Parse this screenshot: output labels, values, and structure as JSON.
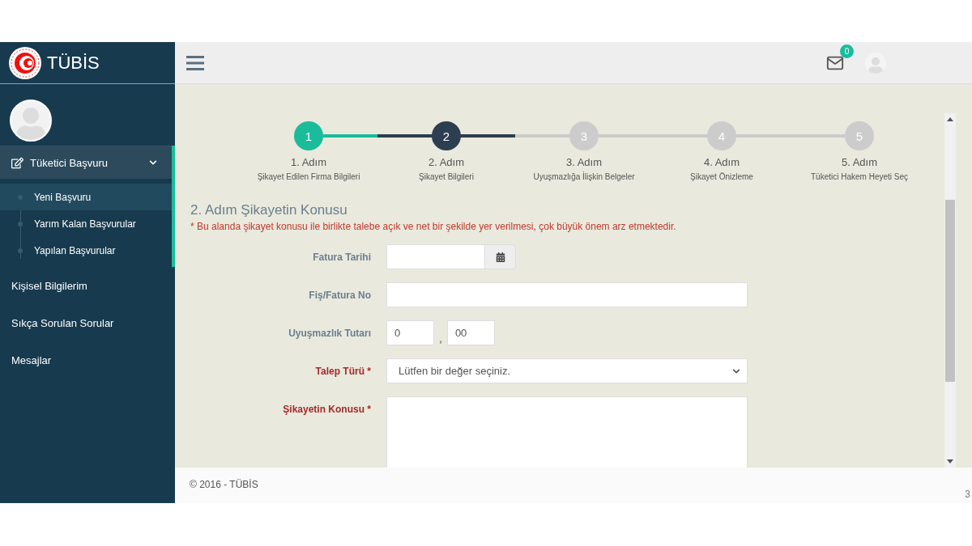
{
  "brand": {
    "name": "TÜBİS"
  },
  "sidebar": {
    "groups": [
      {
        "label": "Tüketici Başvuru",
        "expanded": true,
        "children": [
          {
            "label": "Yeni Başvuru",
            "selected": true
          },
          {
            "label": "Yarım Kalan Başvurular",
            "selected": false
          },
          {
            "label": "Yapılan Başvurular",
            "selected": false
          }
        ]
      }
    ],
    "items": [
      {
        "label": "Kişisel Bilgilerim",
        "selected": false
      },
      {
        "label": "Sıkça Sorulan Sorular",
        "selected": false
      },
      {
        "label": "Mesajlar",
        "selected": false
      }
    ]
  },
  "topbar": {
    "message_count": "0"
  },
  "steps": [
    {
      "number": "1",
      "title": "1. Adım",
      "subtitle": "Şikayet Edilen Firma Bilgileri",
      "completed": true,
      "selected": false
    },
    {
      "number": "2",
      "title": "2. Adım",
      "subtitle": "Şikayet Bilgileri",
      "completed": false,
      "selected": true
    },
    {
      "number": "3",
      "title": "3. Adım",
      "subtitle": "Uyuşmazlığa İlişkin Belgeler",
      "completed": false,
      "selected": false
    },
    {
      "number": "4",
      "title": "4. Adım",
      "subtitle": "Şikayet Önizleme",
      "completed": false,
      "selected": false
    },
    {
      "number": "5",
      "title": "5. Adım",
      "subtitle": "Tüketici Hakem Heyeti Seç",
      "completed": false,
      "selected": false
    }
  ],
  "form": {
    "heading": "2. Adım Şikayetin Konusu",
    "notice": "* Bu alanda şikayet konusu ile birlikte talebe açık ve net bir şekilde yer verilmesi, çok büyük önem arz etmektedir.",
    "fields": [
      {
        "kind": "date",
        "label": "Fatura Tarihi",
        "required": false
      },
      {
        "kind": "text",
        "label": "Fiş/Fatura No",
        "required": false
      },
      {
        "kind": "amount",
        "label": "Uyuşmazlık Tutarı",
        "required": false,
        "whole": "0",
        "separator": ",",
        "fraction": "00"
      },
      {
        "kind": "select",
        "label": "Talep Türü *",
        "required": true,
        "value": "Lütfen bir değer seçiniz."
      },
      {
        "kind": "textarea",
        "label": "Şikayetin Konusu *",
        "required": true
      }
    ]
  },
  "footer": {
    "copyright": "© 2016 - TÜBİS",
    "page_number": "3"
  }
}
